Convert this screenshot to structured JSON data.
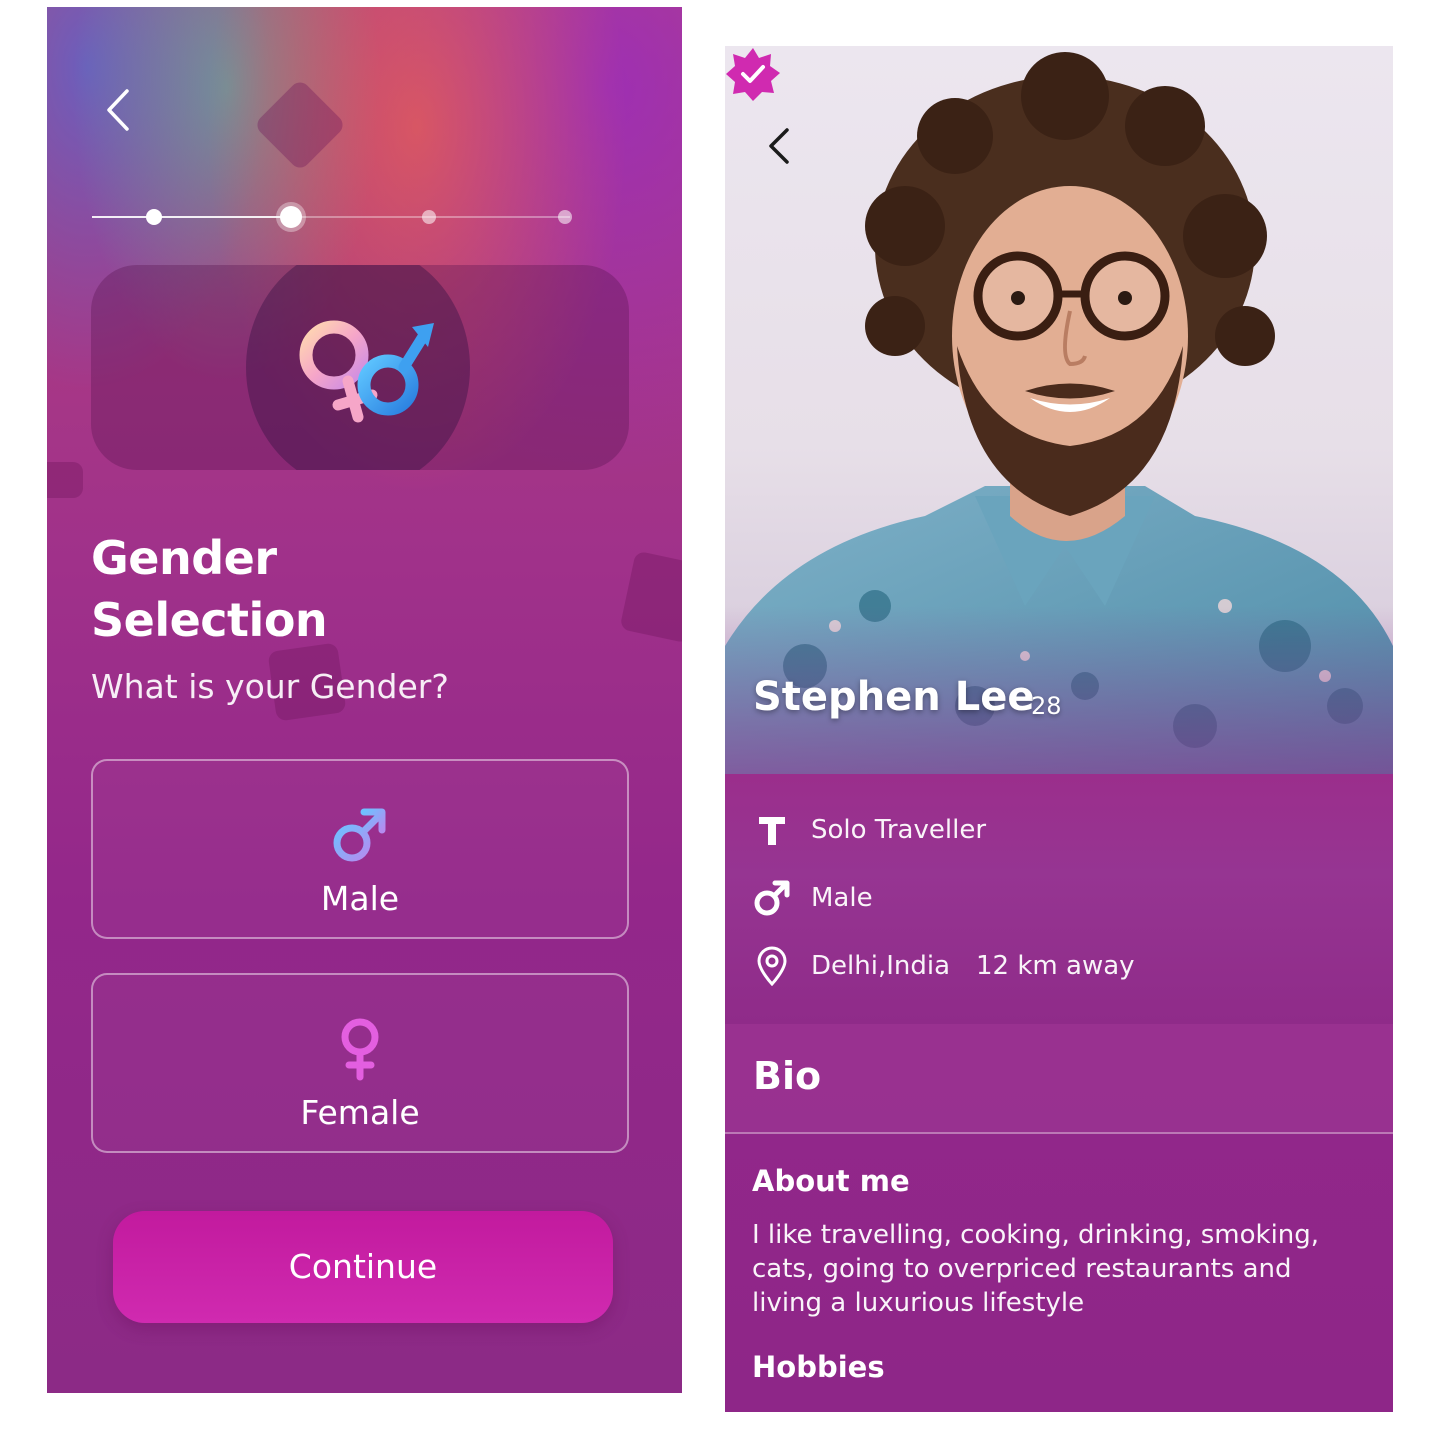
{
  "left_screen": {
    "title_line1": "Gender",
    "title_line2": "Selection",
    "question": "What is your Gender?",
    "progress": {
      "total_steps": 4,
      "current_step": 2
    },
    "options": [
      {
        "label": "Male",
        "icon": "male-symbol-icon"
      },
      {
        "label": "Female",
        "icon": "female-symbol-icon"
      }
    ],
    "continue_label": "Continue",
    "icons": {
      "back": "chevron-left-icon",
      "hero": "gender-symbols-icon"
    }
  },
  "right_screen": {
    "profile": {
      "name": "Stephen Lee",
      "age": "28",
      "verified_icon": "verified-badge-icon"
    },
    "info": {
      "traveller_type": "Solo Traveller",
      "gender": "Male",
      "location": "Delhi,India",
      "distance": "12 km away"
    },
    "bio": {
      "title": "Bio",
      "about_title": "About me",
      "about_text": "I like travelling, cooking, drinking, smoking, cats, going to overpriced restaurants and living a luxurious lifestyle",
      "hobbies_title": "Hobbies"
    },
    "icons": {
      "back": "chevron-left-icon",
      "type": "text-t-icon",
      "gender": "male-symbol-icon",
      "location": "map-pin-icon"
    }
  },
  "colors": {
    "accent": "#c21a9e",
    "male_icon": "#8a9cf0",
    "female_icon": "#e35fe0",
    "verified_badge": "#d02ab0"
  }
}
